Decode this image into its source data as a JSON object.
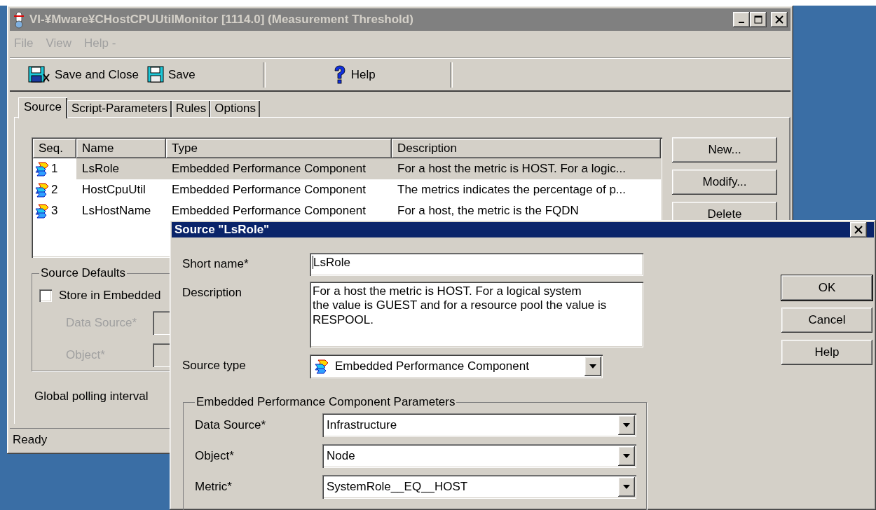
{
  "main_window": {
    "title": "VI-¥Mware¥CHostCPUUtilMonitor [1114.0]  (Measurement Threshold)",
    "active": false,
    "menu": [
      {
        "label": "File",
        "disabled": true
      },
      {
        "label": "View",
        "disabled": true
      },
      {
        "label": "Help -",
        "disabled": true
      }
    ],
    "toolbar": [
      {
        "label": "Save and Close"
      },
      {
        "label": "Save"
      },
      {
        "label": "Help"
      }
    ],
    "tabs": [
      {
        "label": "Source",
        "selected": true
      },
      {
        "label": "Script-Parameters",
        "selected": false
      },
      {
        "label": "Rules",
        "selected": false
      },
      {
        "label": "Options",
        "selected": false
      }
    ],
    "sources": {
      "columns": [
        "Seq.",
        "Name",
        "Type",
        "Description"
      ],
      "rows": [
        {
          "seq": "1",
          "name": "LsRole",
          "type": "Embedded Performance Component",
          "description": "For a host the metric is HOST. For a logic...",
          "selected": true
        },
        {
          "seq": "2",
          "name": "HostCpuUtil",
          "type": "Embedded Performance Component",
          "description": "The metrics indicates the percentage of p...",
          "selected": false
        },
        {
          "seq": "3",
          "name": "LsHostName",
          "type": "Embedded Performance Component",
          "description": "For a host, the metric is the FQDN",
          "selected": false
        }
      ]
    },
    "side_buttons": [
      "New...",
      "Modify...",
      "Delete"
    ],
    "source_defaults": {
      "title": "Source Defaults",
      "store_label": "Store in Embedded",
      "checked": false,
      "fields": [
        {
          "label": "Data Source*",
          "disabled": true
        },
        {
          "label": "Object*",
          "disabled": true
        }
      ]
    },
    "polling_label": "Global polling interval",
    "status_bar": "Ready"
  },
  "dialog": {
    "title": "Source \"LsRole\"",
    "active": true,
    "short_name": {
      "label": "Short name*",
      "value": "LsRole"
    },
    "description": {
      "label": "Description",
      "value": "For a host the metric is HOST. For a logical system\nthe value is GUEST and for a resource pool the value is\nRESPOOL."
    },
    "source_type": {
      "label": "Source type",
      "value": "Embedded Performance Component"
    },
    "parameters": {
      "title": "Embedded Performance Component Parameters",
      "fields": [
        {
          "label": "Data Source*",
          "value": "Infrastructure"
        },
        {
          "label": "Object*",
          "value": "Node"
        },
        {
          "label": "Metric*",
          "value": "SystemRole__EQ__HOST"
        }
      ]
    },
    "buttons": [
      {
        "label": "OK",
        "default": true
      },
      {
        "label": "Cancel",
        "default": false
      },
      {
        "label": "Help",
        "default": false
      }
    ]
  }
}
